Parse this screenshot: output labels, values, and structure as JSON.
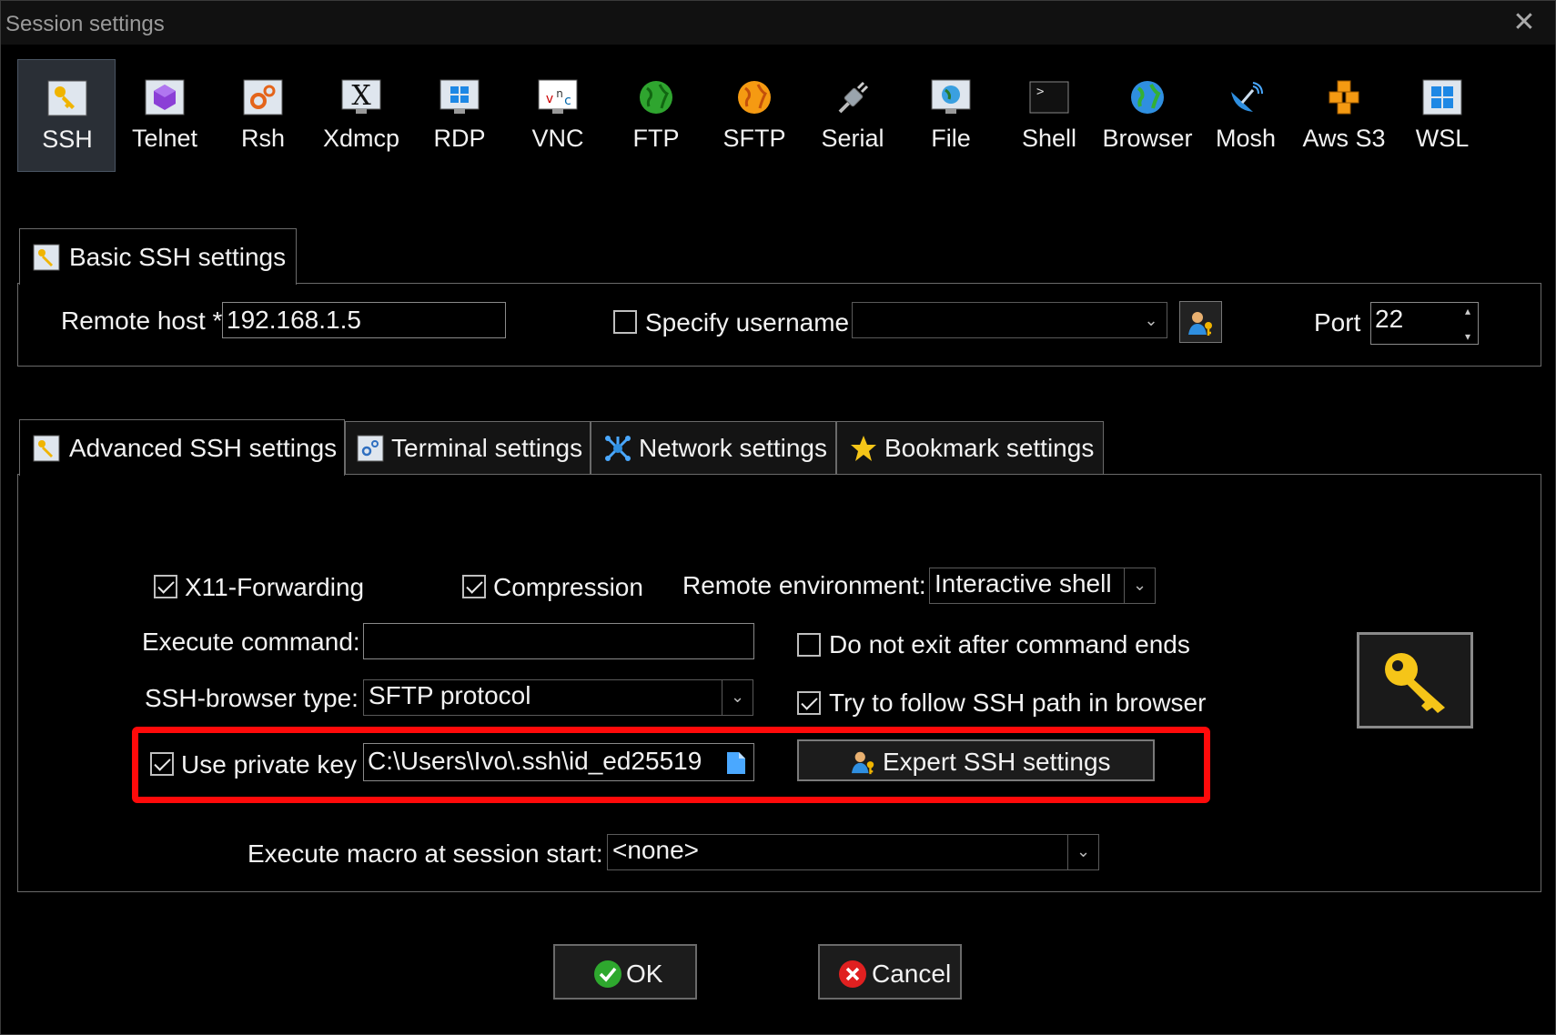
{
  "window": {
    "title": "Session settings",
    "close_icon": "close-icon"
  },
  "session_types": [
    {
      "label": "SSH",
      "icon": "ssh-key-icon",
      "active": true
    },
    {
      "label": "Telnet",
      "icon": "telnet-icon"
    },
    {
      "label": "Rsh",
      "icon": "rsh-icon"
    },
    {
      "label": "Xdmcp",
      "icon": "xdmcp-icon"
    },
    {
      "label": "RDP",
      "icon": "rdp-icon"
    },
    {
      "label": "VNC",
      "icon": "vnc-icon"
    },
    {
      "label": "FTP",
      "icon": "ftp-globe-icon"
    },
    {
      "label": "SFTP",
      "icon": "sftp-globe-icon"
    },
    {
      "label": "Serial",
      "icon": "serial-plug-icon"
    },
    {
      "label": "File",
      "icon": "file-monitor-icon"
    },
    {
      "label": "Shell",
      "icon": "shell-terminal-icon"
    },
    {
      "label": "Browser",
      "icon": "browser-globe-icon"
    },
    {
      "label": "Mosh",
      "icon": "mosh-satellite-icon"
    },
    {
      "label": "Aws S3",
      "icon": "aws-s3-cubes-icon"
    },
    {
      "label": "WSL",
      "icon": "wsl-windows-icon"
    }
  ],
  "basic": {
    "tab_label": "Basic SSH settings",
    "remote_host_label": "Remote host *",
    "remote_host_value": "192.168.1.5",
    "specify_username_label": "Specify username",
    "specify_username_checked": false,
    "username_value": "",
    "port_label": "Port",
    "port_value": "22"
  },
  "tabs": [
    {
      "label": "Advanced SSH settings",
      "icon": "ssh-key-icon",
      "active": true
    },
    {
      "label": "Terminal settings",
      "icon": "terminal-settings-icon"
    },
    {
      "label": "Network settings",
      "icon": "network-icon"
    },
    {
      "label": "Bookmark settings",
      "icon": "star-icon"
    }
  ],
  "advanced": {
    "x11_label": "X11-Forwarding",
    "x11_checked": true,
    "compression_label": "Compression",
    "compression_checked": true,
    "remote_env_label": "Remote environment:",
    "remote_env_value": "Interactive shell",
    "exec_cmd_label": "Execute command:",
    "exec_cmd_value": "",
    "no_exit_label": "Do not exit after command ends",
    "no_exit_checked": false,
    "browser_type_label": "SSH-browser type:",
    "browser_type_value": "SFTP protocol",
    "follow_path_label": "Try to follow SSH path in browser",
    "follow_path_checked": true,
    "private_key_label": "Use private key",
    "private_key_checked": true,
    "private_key_value": "C:\\Users\\Ivo\\.ssh\\id_ed25519",
    "expert_label": "Expert SSH settings",
    "macro_label": "Execute macro at session start:",
    "macro_value": "<none>"
  },
  "buttons": {
    "ok": "OK",
    "cancel": "Cancel"
  },
  "colors": {
    "highlight": "#ff0a0a",
    "background": "#000000",
    "accent_key": "#f5c518"
  }
}
